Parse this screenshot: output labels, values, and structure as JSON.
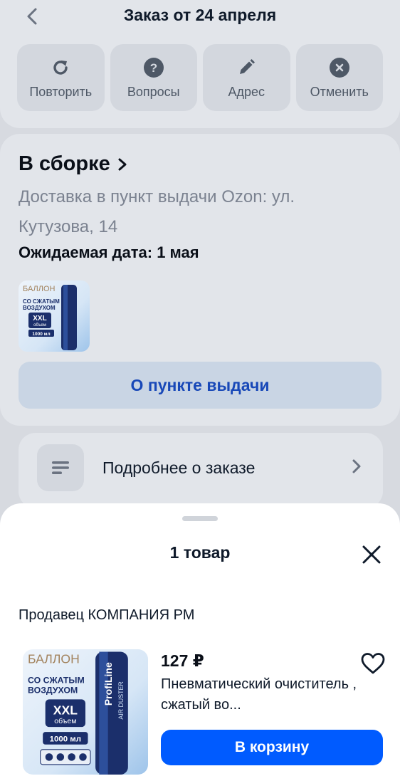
{
  "header": {
    "title": "Заказ от 24 апреля",
    "actions": [
      {
        "label": "Повторить",
        "icon": "refresh-icon"
      },
      {
        "label": "Вопросы",
        "icon": "question-icon"
      },
      {
        "label": "Адрес",
        "icon": "pencil-icon"
      },
      {
        "label": "Отменить",
        "icon": "cancel-icon"
      }
    ]
  },
  "status": {
    "title": "В сборке",
    "delivery": "Доставка в пункт выдачи Ozon: ул. Кутузова, 14",
    "expected_date": "Ожидаемая дата: 1 мая",
    "pickup_button": "О пункте выдачи"
  },
  "details": {
    "label": "Подробнее о заказе"
  },
  "sheet": {
    "title": "1 товар",
    "seller": "Продавец КОМПАНИЯ РМ",
    "product": {
      "price": "127 ₽",
      "name": "Пневматический очиститель , сжатый во...",
      "cart_button": "В корзину",
      "image_text": {
        "baloon": "БАЛЛОН",
        "line1": "СО СЖАТЫМ",
        "line2": "ВОЗДУХОМ",
        "xxl": "XXL",
        "volume_word": "объем",
        "volume": "1000 мл",
        "brand": "ProfiLine",
        "can_label": "AIR DUSTER"
      }
    }
  },
  "colors": {
    "accent": "#005bff",
    "link": "#1848b8",
    "overlay_bg": "#d7dae0"
  }
}
